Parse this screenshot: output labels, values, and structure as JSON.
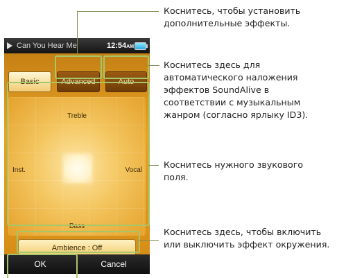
{
  "device": {
    "status_bar": {
      "song_title": "Can You Hear Me",
      "time": "12:54",
      "am_pm": "AM"
    },
    "tabs": [
      {
        "label": "Basic",
        "selected": true
      },
      {
        "label": "Advanced",
        "selected": false
      },
      {
        "label": "Auto",
        "selected": false
      }
    ],
    "sound_field": {
      "top_label": "Treble",
      "bottom_label": "Bass",
      "left_label": "Inst.",
      "right_label": "Vocal"
    },
    "ambience_button": "Ambience : Off",
    "soft_keys": {
      "ok": "OK",
      "cancel": "Cancel"
    }
  },
  "callouts": [
    {
      "id": "advanced",
      "text": "Коснитесь, чтобы установить\nдополнительные эффекты."
    },
    {
      "id": "auto",
      "text": "Коснитесь здесь для\nавтоматического наложения\nэффектов SoundAlive в\nсоответствии с музыкальным\nжанром (согласно ярлыку ID3)."
    },
    {
      "id": "sound_field",
      "text": "Коснитесь нужного звукового\nполя."
    },
    {
      "id": "ambience",
      "text": "Коснитесь здесь, чтобы включить\nили выключить эффект окружения."
    }
  ],
  "colors": {
    "highlight": "#a4c76a",
    "leader_line": "#7f8f56",
    "field_orange": "#e8a325"
  }
}
